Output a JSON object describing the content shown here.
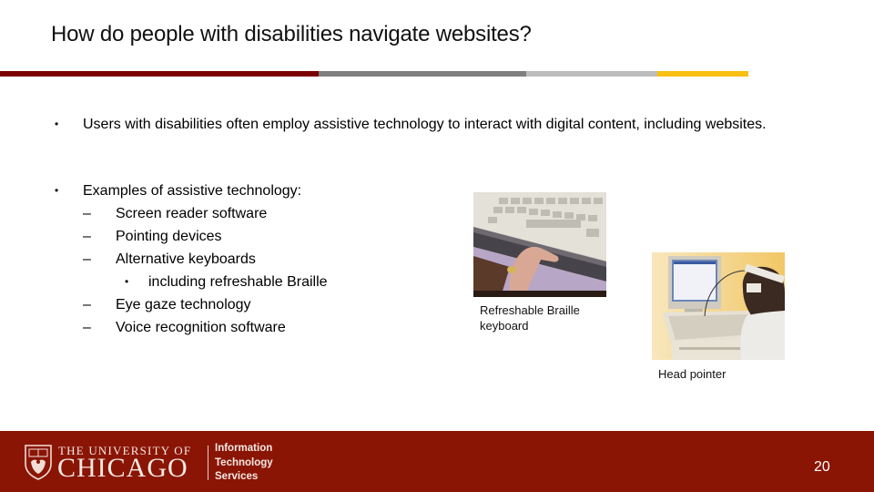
{
  "slide": {
    "title": "How do people with disabilities navigate websites?",
    "accent_colors": [
      "#7c0000",
      "#7f7f7f",
      "#bdbdbd",
      "#f9bf12"
    ],
    "bullets": [
      {
        "marker": "•",
        "text": "Users with disabilities often employ assistive technology to interact with digital content, including websites."
      },
      {
        "marker": "•",
        "text": "Examples of assistive technology:",
        "subitems": [
          {
            "marker": "–",
            "text": "Screen reader software"
          },
          {
            "marker": "–",
            "text": "Pointing devices"
          },
          {
            "marker": "–",
            "text": "Alternative keyboards",
            "subitems": [
              {
                "marker": "•",
                "text": "including refreshable Braille"
              }
            ]
          },
          {
            "marker": "–",
            "text": "Eye gaze technology"
          },
          {
            "marker": "–",
            "text": "Voice recognition software"
          }
        ]
      }
    ],
    "images": [
      {
        "name": "refreshable-braille-keyboard-photo",
        "caption_line1": "Refreshable Braille",
        "caption_line2": "keyboard"
      },
      {
        "name": "head-pointer-photo",
        "caption": "Head pointer"
      }
    ]
  },
  "footer": {
    "background": "#8a1505",
    "logo": {
      "line1": "THE UNIVERSITY OF",
      "line2": "CHICAGO",
      "dept_line1": "Information",
      "dept_line2": "Technology",
      "dept_line3": "Services"
    },
    "page_number": "20"
  }
}
